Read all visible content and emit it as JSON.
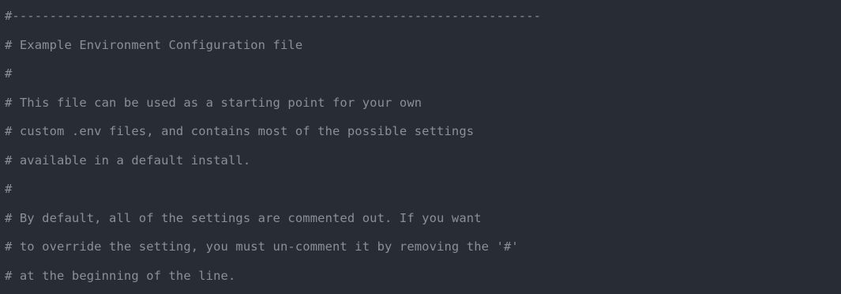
{
  "code_view": {
    "language": "env",
    "comment_color": "#8a8f98",
    "background_color": "#282c34",
    "lines": [
      "#-----------------------------------------------------------------------",
      "# Example Environment Configuration file",
      "#",
      "# This file can be used as a starting point for your own",
      "# custom .env files, and contains most of the possible settings",
      "# available in a default install.",
      "#",
      "# By default, all of the settings are commented out. If you want",
      "# to override the setting, you must un-comment it by removing the '#'",
      "# at the beginning of the line."
    ]
  }
}
